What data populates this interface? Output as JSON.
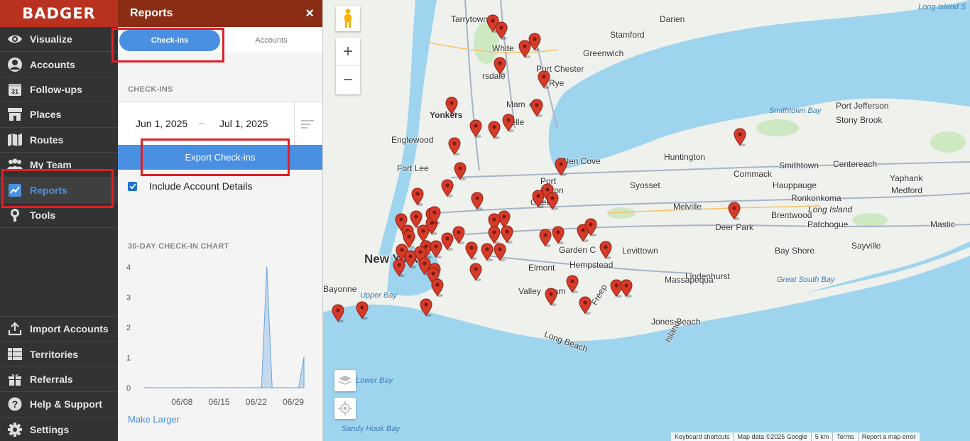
{
  "nav": {
    "brand": "BADGER",
    "items": [
      {
        "label": "Visualize",
        "icon": "eye-icon"
      },
      {
        "label": "Accounts",
        "icon": "user-icon"
      },
      {
        "label": "Follow-ups",
        "icon": "calendar-icon",
        "icon_text": "31"
      },
      {
        "label": "Places",
        "icon": "store-icon"
      },
      {
        "label": "Routes",
        "icon": "map-icon"
      },
      {
        "label": "My Team",
        "icon": "team-icon"
      },
      {
        "label": "Reports",
        "icon": "chart-icon",
        "active": true
      },
      {
        "label": "Tools",
        "icon": "tools-icon"
      }
    ],
    "bottom_items": [
      {
        "label": "Import Accounts",
        "icon": "upload-icon"
      },
      {
        "label": "Territories",
        "icon": "grid-icon"
      },
      {
        "label": "Referrals",
        "icon": "gift-icon"
      },
      {
        "label": "Help & Support",
        "icon": "help-icon"
      },
      {
        "label": "Settings",
        "icon": "gear-icon"
      }
    ],
    "active_color": "#4a90e2"
  },
  "panel": {
    "title": "Reports",
    "close": "×",
    "tabs": {
      "checkins": "Check-ins",
      "accounts": "Accounts"
    },
    "section_checkins": "CHECK-INS",
    "date_start": "Jun 1, 2025",
    "date_separator": "–",
    "date_end": "Jul 1, 2025",
    "export_label": "Export Check-ins",
    "include_label": "Include Account Details",
    "include_checked": true,
    "section_chart": "30-DAY CHECK-IN CHART",
    "make_larger": "Make Larger",
    "header_color": "#8a2d14",
    "accent_color": "#4a90e2"
  },
  "chart_data": {
    "type": "area",
    "title": "",
    "xlabel": "",
    "ylabel": "",
    "ylim": [
      0,
      4
    ],
    "yticks": [
      0,
      1,
      2,
      3,
      4
    ],
    "xticks": [
      "06/08",
      "06/15",
      "06/22",
      "06/29"
    ],
    "x": [
      "06/01",
      "06/02",
      "06/03",
      "06/04",
      "06/05",
      "06/06",
      "06/07",
      "06/08",
      "06/09",
      "06/10",
      "06/11",
      "06/12",
      "06/13",
      "06/14",
      "06/15",
      "06/16",
      "06/17",
      "06/18",
      "06/19",
      "06/20",
      "06/21",
      "06/22",
      "06/23",
      "06/24",
      "06/25",
      "06/26",
      "06/27",
      "06/28",
      "06/29",
      "06/30",
      "07/01"
    ],
    "values": [
      0,
      0,
      0,
      0,
      0,
      0,
      0,
      0,
      0,
      0,
      0,
      0,
      0,
      0,
      0,
      0,
      0,
      0,
      0,
      0,
      0,
      0,
      0,
      4,
      0,
      0,
      0,
      0,
      0,
      0,
      1
    ],
    "grid": false,
    "color": "#9dc3ea"
  },
  "map": {
    "controls": {
      "zoom_in": "+",
      "zoom_out": "−"
    },
    "labels": [
      {
        "text": "Tarrytown"
      },
      {
        "text": "Darien"
      },
      {
        "text": "Long Island S",
        "water": true
      },
      {
        "text": "Stamford"
      },
      {
        "text": "White"
      },
      {
        "text": "Greenwich"
      },
      {
        "text": "Port Chester"
      },
      {
        "text": "rsdale"
      },
      {
        "text": "Rye"
      },
      {
        "text": "Mam"
      },
      {
        "text": "eck"
      },
      {
        "text": "Yonkers",
        "bold": true
      },
      {
        "text": "helle"
      },
      {
        "text": "Smithtown Bay",
        "water": true
      },
      {
        "text": "Port Jefferson"
      },
      {
        "text": "Stony Brook"
      },
      {
        "text": "Englewood"
      },
      {
        "text": "Glen Cove"
      },
      {
        "text": "Huntington"
      },
      {
        "text": "Fort Lee"
      },
      {
        "text": "Port"
      },
      {
        "text": "Commack"
      },
      {
        "text": "Smithtown"
      },
      {
        "text": "Centereach"
      },
      {
        "text": "Yaphank"
      },
      {
        "text": "ington"
      },
      {
        "text": "Gre"
      },
      {
        "text": "eck"
      },
      {
        "text": "Syosset"
      },
      {
        "text": "Hauppauge"
      },
      {
        "text": "Ronkonkoma"
      },
      {
        "text": "Medford"
      },
      {
        "text": "Melville"
      },
      {
        "text": "Brentwood"
      },
      {
        "text": "Long Island",
        "italic": true
      },
      {
        "text": "Deer Park"
      },
      {
        "text": "Patchogue"
      },
      {
        "text": "Mastic"
      },
      {
        "text": "New York",
        "big": true
      },
      {
        "text": "Garden C"
      },
      {
        "text": "Levittown"
      },
      {
        "text": "Bay Shore"
      },
      {
        "text": "Sayville"
      },
      {
        "text": "Elmont"
      },
      {
        "text": "Hempstead"
      },
      {
        "text": "Lindenhurst"
      },
      {
        "text": "Bayonne"
      },
      {
        "text": "Valley"
      },
      {
        "text": "eam"
      },
      {
        "text": "Freep"
      },
      {
        "text": "Massapequa"
      },
      {
        "text": "Great South Bay",
        "water": true
      },
      {
        "text": "Upper Bay",
        "water": true
      },
      {
        "text": "Jones Beach"
      },
      {
        "text": "Island"
      },
      {
        "text": "Long Beach"
      },
      {
        "text": "Lower Bay",
        "water": true
      },
      {
        "text": "Sandy Hook Bay",
        "water": true
      }
    ],
    "attribution": [
      "Keyboard shortcuts",
      "Map data ©2025 Google",
      "5 km",
      "Terms",
      "Report a map error"
    ],
    "pin_color": "#d63b2a",
    "water_color": "#9fd4ef",
    "land_color": "#eef1ec"
  }
}
